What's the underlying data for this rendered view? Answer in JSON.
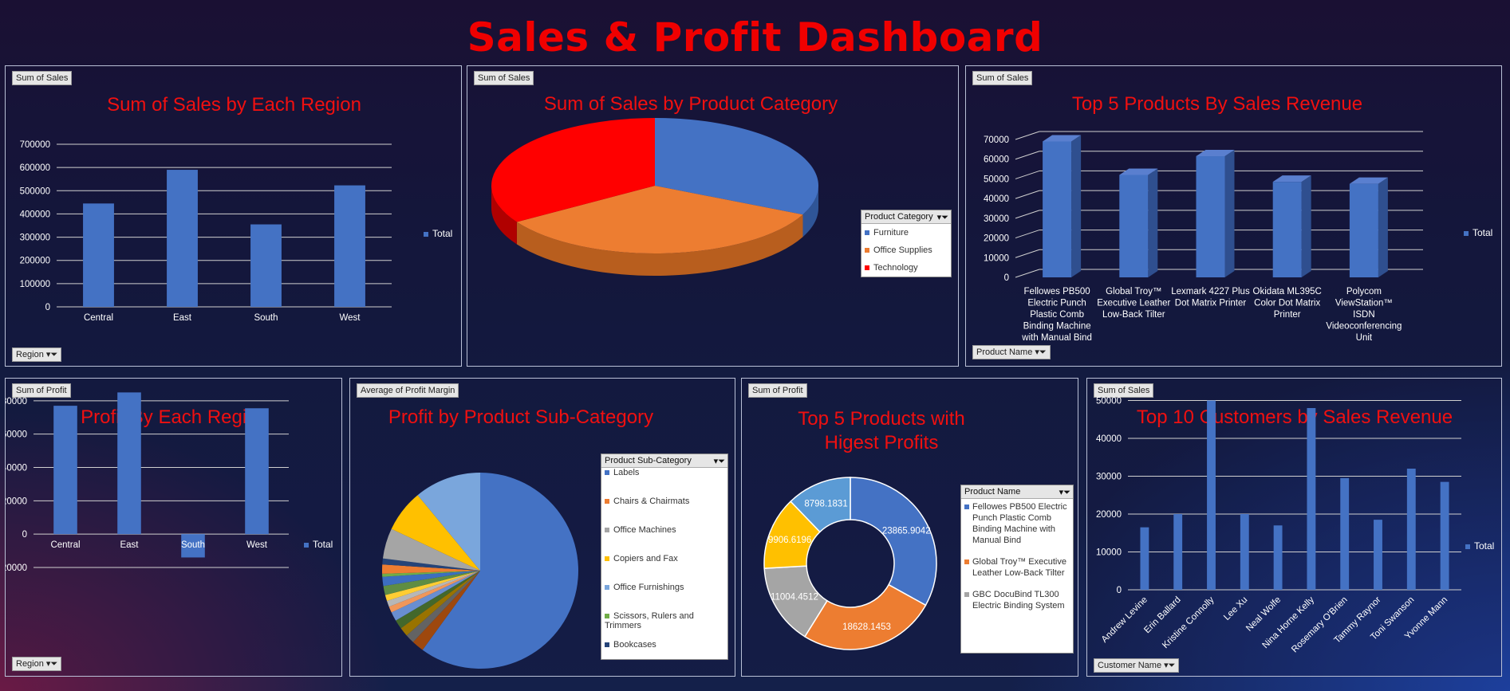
{
  "dashboard": {
    "title": "Sales & Profit Dashboard"
  },
  "colors": {
    "bar": "#4472c4",
    "title": "#f01010",
    "furniture": "#4472c4",
    "office": "#ed7d31",
    "technology": "#ff0000"
  },
  "panels": {
    "p1": {
      "badge": "Sum of Sales",
      "title": "Sum of Sales by Each Region",
      "filter": "Region",
      "legend": "Total"
    },
    "p2": {
      "badge": "Sum of Sales",
      "title": "Sum of Sales by Product Category",
      "legend_header": "Product Category",
      "legend_items": [
        "Furniture",
        "Office Supplies",
        "Technology"
      ]
    },
    "p3": {
      "badge": "Sum of Sales",
      "title": "Top 5  Products By Sales Revenue",
      "filter": "Product Name",
      "legend": "Total"
    },
    "p4": {
      "badge": "Sum of Profit",
      "title": "Profit By Each Region",
      "filter": "Region",
      "legend": "Total"
    },
    "p5": {
      "badge": "Average of Profit Margin",
      "title": "Profit by Product Sub-Category",
      "legend_header": "Product Sub-Category",
      "legend_items": [
        "Labels",
        "Chairs & Chairmats",
        "Office Machines",
        "Copiers and Fax",
        "Office Furnishings",
        "Scissors, Rulers and Trimmers",
        "Bookcases"
      ]
    },
    "p6": {
      "badge": "Sum of Profit",
      "title": "Top 5 Products with Higest Profits",
      "legend_header": "Product Name",
      "legend_items": [
        "Fellowes PB500 Electric Punch Plastic Comb Binding Machine with Manual Bind",
        "Global Troy™ Executive Leather Low-Back Tilter",
        "GBC DocuBind TL300 Electric Binding System"
      ]
    },
    "p7": {
      "badge": "Sum of Sales",
      "title": "Top 10 Customers by Sales Revenue",
      "filter": "Customer Name",
      "legend": "Total"
    }
  },
  "chart_data": [
    {
      "type": "bar",
      "title": "Sum of Sales by Each Region",
      "categories": [
        "Central",
        "East",
        "South",
        "West"
      ],
      "values": [
        445000,
        590000,
        355000,
        523000
      ],
      "ylim": [
        0,
        700000
      ],
      "yticks": [
        "0",
        "100000",
        "200000",
        "300000",
        "400000",
        "500000",
        "600000",
        "700000"
      ],
      "series_name": "Total"
    },
    {
      "type": "pie",
      "title": "Sum of Sales by Product Category",
      "categories": [
        "Furniture",
        "Office Supplies",
        "Technology"
      ],
      "values": [
        32,
        34,
        34
      ]
    },
    {
      "type": "bar",
      "title": "Top 5  Products By Sales Revenue",
      "categories": [
        "Fellowes PB500 Electric Punch Plastic Comb Binding Machine with Manual Bind",
        "Global Troy™ Executive Leather Low-Back Tilter",
        "Lexmark 4227 Plus Dot Matrix Printer",
        "Okidata ML395C Color Dot Matrix Printer",
        "Polycom ViewStation™ ISDN Videoconferencing Unit"
      ],
      "category_lines": [
        [
          "Fellowes PB500",
          "Electric Punch",
          "Plastic Comb",
          "Binding Machine",
          "with Manual Bind"
        ],
        [
          "Global Troy™",
          "Executive Leather",
          "Low-Back Tilter"
        ],
        [
          "Lexmark 4227 Plus",
          "Dot Matrix Printer"
        ],
        [
          "Okidata ML395C",
          "Color Dot Matrix",
          "Printer"
        ],
        [
          "Polycom",
          "ViewStation™",
          "ISDN",
          "Videoconferencing",
          "Unit"
        ]
      ],
      "values": [
        69000,
        52000,
        61500,
        48500,
        47500
      ],
      "ylim": [
        0,
        70000
      ],
      "yticks": [
        "0",
        "10000",
        "20000",
        "30000",
        "40000",
        "50000",
        "60000",
        "70000"
      ],
      "series_name": "Total"
    },
    {
      "type": "bar",
      "title": "Profit By Each Region",
      "categories": [
        "Central",
        "East",
        "South",
        "West"
      ],
      "values": [
        77000,
        85000,
        -14000,
        75500
      ],
      "ylim": [
        -20000,
        100000
      ],
      "yticks": [
        "-20000",
        "0",
        "20000",
        "40000",
        "60000",
        "80000",
        "100000"
      ],
      "series_name": "Total"
    },
    {
      "type": "pie",
      "title": "Profit by Product Sub-Category",
      "categories": [
        "Labels",
        "Chairs & Chairmats",
        "Office Machines",
        "Copiers and Fax",
        "Office Furnishings",
        "Scissors, Rulers and Trimmers",
        "Bookcases"
      ],
      "values": [
        60,
        1.5,
        5,
        7,
        11,
        0.5,
        1
      ],
      "other_slices": [
        2,
        1.5,
        1.5,
        1.5,
        1.5,
        1,
        1,
        1,
        1.5,
        1.5
      ]
    },
    {
      "type": "pie",
      "title": "Top 5 Products with Higest Profits",
      "donut": true,
      "values": [
        23865.9042,
        18628.1453,
        11004.4512,
        9906.6196,
        8798.1831
      ],
      "labels": [
        "23865.9042",
        "18628.1453",
        "11004.4512",
        "9906.6196",
        "8798.1831"
      ]
    },
    {
      "type": "bar",
      "title": "Top 10 Customers by Sales Revenue",
      "categories": [
        "Andrew Levine",
        "Erin Ballard",
        "Kristine Connolly",
        "Lee Xu",
        "Neal Wolfe",
        "Nina Horne Kelly",
        "Rosemary O'Brien",
        "Tammy Raynor",
        "Toni Swanson",
        "Yvonne Mann"
      ],
      "values": [
        16500,
        20000,
        50000,
        20000,
        17000,
        48000,
        29500,
        18500,
        32000,
        28500
      ],
      "ylim": [
        0,
        60000
      ],
      "yticks": [
        "0",
        "10000",
        "20000",
        "30000",
        "40000",
        "50000",
        "60000"
      ],
      "series_name": "Total"
    }
  ]
}
